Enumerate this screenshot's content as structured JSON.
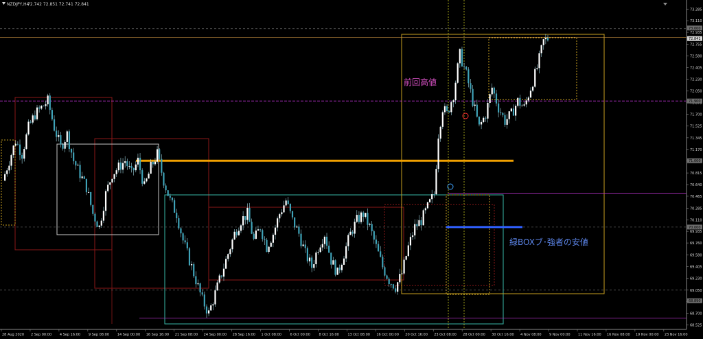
{
  "header": {
    "symbol": "NZDJPY,H4",
    "ohlc": "72.742 72.851 72.741 72.841"
  },
  "annotations": {
    "prev_high": "前回高値",
    "green_box_note": "緑BOXブ･強者の安値"
  },
  "colors": {
    "background": "#000000",
    "bull": "#ffffff",
    "bear": "#3fa3b8",
    "wick": "#9fd6e2",
    "white_box": "#c8c8c8",
    "green_box": "#39b7a8",
    "gold_box": "#c8a020",
    "red_box": "#8c1818",
    "orange_line": "#f0a000",
    "blue_line": "#3060ff",
    "magenta_line": "#b432c8"
  },
  "chart_data": {
    "type": "candlestick",
    "y_ticks": [
      "73.285",
      "73.110",
      "72.935",
      "72.755",
      "72.580",
      "72.405",
      "72.230",
      "72.050",
      "71.875",
      "71.700",
      "71.525",
      "71.345",
      "71.170",
      "70.995",
      "70.815",
      "70.640",
      "70.465",
      "70.285",
      "70.110",
      "69.935",
      "69.760",
      "69.580",
      "69.405",
      "69.230",
      "69.050",
      "68.875",
      "68.700",
      "68.525"
    ],
    "ylim": [
      68.52,
      73.36
    ],
    "price_tags": [
      "73.000",
      "72.841",
      "71.900",
      "71.000",
      "70.000",
      "68.890"
    ],
    "x_labels": [
      "28 Aug 2020",
      "2 Sep 00:00",
      "4 Sep 16:00",
      "9 Sep 08:00",
      "14 Sep 00:00",
      "16 Sep 16:00",
      "21 Sep 08:00",
      "24 Sep 00:00",
      "28 Sep 16:00",
      "1 Oct 08:00",
      "6 Oct 00:00",
      "8 Oct 16:00",
      "13 Oct 08:00",
      "16 Oct 00:00",
      "20 Oct 16:00",
      "23 Oct 08:00",
      "28 Oct 00:00",
      "30 Oct 16:00",
      "4 Nov 08:00",
      "9 Nov 00:00",
      "11 Nov 16:00",
      "16 Nov 08:00",
      "19 Nov 00:00",
      "23 Nov 16:00"
    ],
    "key_levels": [
      {
        "price": 71.0,
        "style": "orange-horizontal"
      },
      {
        "price": 70.0,
        "style": "blue-horizontal"
      },
      {
        "price": 71.9,
        "style": "magenta-horizontal"
      }
    ],
    "price_path": [
      [
        0,
        70.7
      ],
      [
        3,
        71.0
      ],
      [
        6,
        71.3
      ],
      [
        9,
        71.1
      ],
      [
        12,
        71.5
      ],
      [
        15,
        71.7
      ],
      [
        18,
        71.8
      ],
      [
        21,
        71.9
      ],
      [
        24,
        71.5
      ],
      [
        27,
        71.2
      ],
      [
        30,
        71.4
      ],
      [
        33,
        71.0
      ],
      [
        36,
        70.8
      ],
      [
        39,
        70.6
      ],
      [
        42,
        70.2
      ],
      [
        45,
        70.0
      ],
      [
        48,
        70.5
      ],
      [
        51,
        70.8
      ],
      [
        54,
        70.9
      ],
      [
        57,
        71.0
      ],
      [
        60,
        70.8
      ],
      [
        63,
        71.0
      ],
      [
        66,
        70.6
      ],
      [
        69,
        70.9
      ],
      [
        72,
        71.1
      ],
      [
        75,
        70.7
      ],
      [
        78,
        70.4
      ],
      [
        81,
        70.2
      ],
      [
        84,
        69.8
      ],
      [
        87,
        69.5
      ],
      [
        90,
        69.2
      ],
      [
        93,
        68.9
      ],
      [
        96,
        68.7
      ],
      [
        99,
        69.0
      ],
      [
        102,
        69.3
      ],
      [
        105,
        69.6
      ],
      [
        108,
        69.9
      ],
      [
        111,
        70.1
      ],
      [
        114,
        70.2
      ],
      [
        117,
        69.8
      ],
      [
        120,
        70.0
      ],
      [
        123,
        69.7
      ],
      [
        126,
        69.9
      ],
      [
        129,
        70.2
      ],
      [
        132,
        70.4
      ],
      [
        135,
        70.1
      ],
      [
        138,
        69.9
      ],
      [
        141,
        69.6
      ],
      [
        144,
        69.4
      ],
      [
        147,
        69.7
      ],
      [
        150,
        69.9
      ],
      [
        153,
        69.5
      ],
      [
        156,
        69.3
      ],
      [
        159,
        69.6
      ],
      [
        162,
        69.9
      ],
      [
        165,
        70.1
      ],
      [
        168,
        70.2
      ],
      [
        171,
        70.0
      ],
      [
        174,
        69.7
      ],
      [
        177,
        69.4
      ],
      [
        180,
        69.2
      ],
      [
        183,
        69.1
      ],
      [
        186,
        69.3
      ],
      [
        189,
        69.7
      ],
      [
        192,
        70.0
      ],
      [
        195,
        70.1
      ],
      [
        198,
        70.3
      ],
      [
        201,
        70.5
      ],
      [
        203,
        71.4
      ],
      [
        205,
        71.8
      ],
      [
        207,
        71.7
      ],
      [
        210,
        72.0
      ],
      [
        213,
        72.6
      ],
      [
        216,
        72.3
      ],
      [
        219,
        71.9
      ],
      [
        222,
        71.5
      ],
      [
        225,
        71.7
      ],
      [
        228,
        72.1
      ],
      [
        231,
        71.8
      ],
      [
        234,
        71.6
      ],
      [
        237,
        71.7
      ],
      [
        240,
        71.9
      ],
      [
        243,
        71.8
      ],
      [
        246,
        72.1
      ],
      [
        249,
        72.4
      ],
      [
        252,
        72.8
      ],
      [
        254,
        72.84
      ]
    ]
  }
}
